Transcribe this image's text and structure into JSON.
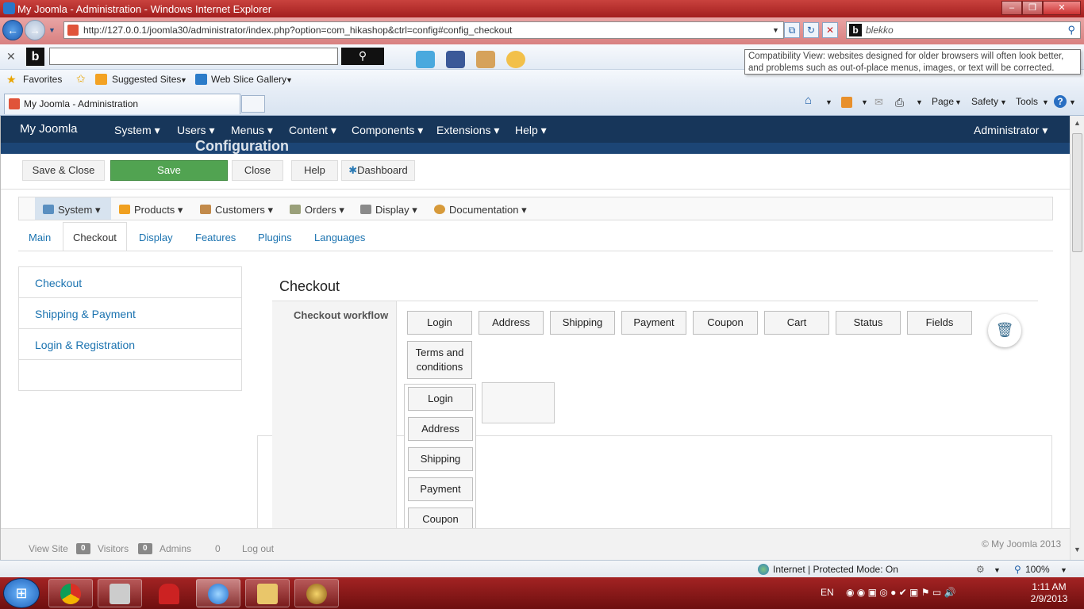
{
  "window": {
    "title": "My Joomla - Administration - Windows Internet Explorer",
    "controls": [
      "‒",
      "❐",
      "✕"
    ]
  },
  "address_bar": {
    "url": "http://127.0.0.1/joomla30/administrator/index.php?option=com_hikashop&ctrl=config#config_checkout",
    "search_value": "blekko"
  },
  "toolbar": {
    "search_logo": "b",
    "tooltip": "Compatibility View: websites designed for older browsers will often look better, and problems such as out-of-place menus, images, or text will be corrected."
  },
  "favorites_bar": {
    "favorites": "Favorites",
    "suggested_sites": "Suggested Sites",
    "web_slice_gallery": "Web Slice Gallery"
  },
  "tab_bar": {
    "active_tab": "My Joomla - Administration",
    "commands": {
      "page": "Page",
      "safety": "Safety",
      "tools": "Tools"
    }
  },
  "joomla_nav": {
    "brand": "My Joomla",
    "items": [
      "System",
      "Users",
      "Menus",
      "Content",
      "Components",
      "Extensions",
      "Help"
    ],
    "user": "Administrator",
    "partial_header": "Configuration"
  },
  "action_toolbar": {
    "save_close": "Save & Close",
    "save": "Save",
    "close": "Close",
    "help": "Help",
    "dashboard": "Dashboard"
  },
  "hikashop_menu": {
    "items": [
      "System",
      "Products",
      "Customers",
      "Orders",
      "Display",
      "Documentation"
    ]
  },
  "config_tabs": [
    "Main",
    "Checkout",
    "Display",
    "Features",
    "Plugins",
    "Languages"
  ],
  "left_nav": [
    "Checkout",
    "Shipping & Payment",
    "Login & Registration"
  ],
  "section": {
    "title": "Checkout",
    "workflow_label": "Checkout workflow",
    "workflow_buttons": [
      "Login",
      "Address",
      "Shipping",
      "Payment",
      "Coupon",
      "Cart",
      "Status",
      "Fields"
    ],
    "terms_button": "Terms and conditions",
    "dropdown_items": [
      "Login",
      "Address",
      "Shipping",
      "Payment",
      "Coupon"
    ]
  },
  "footer": {
    "view_site": "View Site",
    "visitors_count": "0",
    "visitors": "Visitors",
    "admins_count": "0",
    "admins": "Admins",
    "messages_count": "0",
    "logout": "Log out",
    "copyright": "© My Joomla 2013"
  },
  "status_bar": {
    "zone": "Internet | Protected Mode: On",
    "zoom": "100%"
  },
  "taskbar": {
    "language": "EN",
    "time": "1:11 AM",
    "date": "2/9/2013"
  },
  "colors": {
    "joomla_nav": "#17365a",
    "save_button": "#51a351",
    "link": "#1b73b0",
    "ie_frame": "#a31e1e"
  }
}
